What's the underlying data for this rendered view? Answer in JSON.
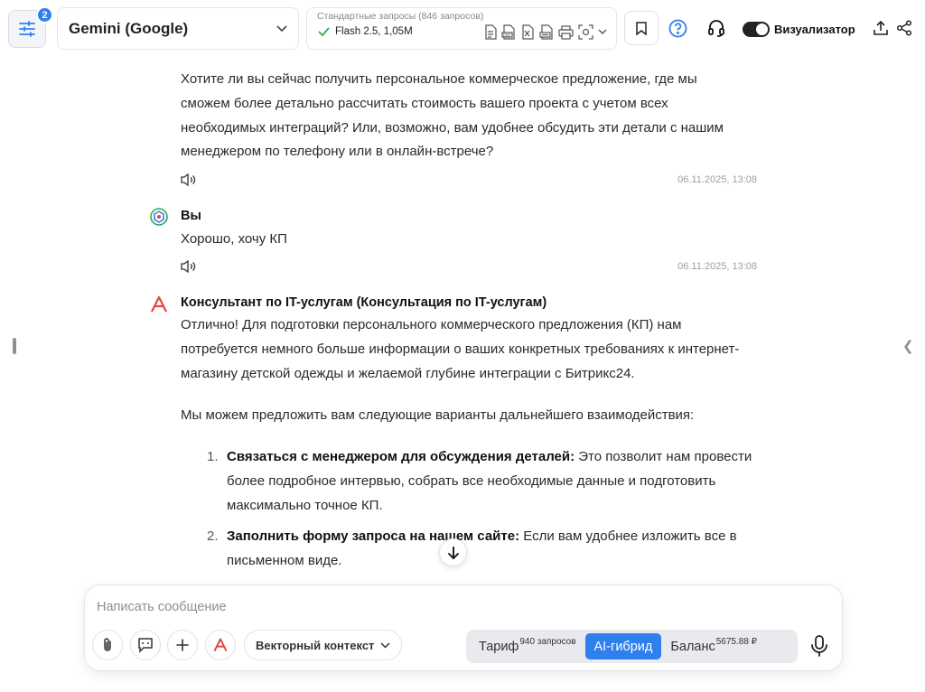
{
  "header": {
    "settings_badge": "2",
    "model_name": "Gemini (Google)",
    "requests_title": "Стандартные запросы (846 запросов)",
    "requests_model": "Flash 2.5, 1,05M",
    "visualizer_label": "Визуализатор"
  },
  "messages": {
    "m1": {
      "lines": [
        "Хотите ли вы сейчас получить персональное коммерческое предложение, где мы",
        "сможем более детально рассчитать стоимость вашего проекта с учетом всех",
        "необходимых интеграций? Или, возможно, вам удобнее обсудить эти детали с нашим",
        "менеджером по телефону или в онлайн-встрече?"
      ],
      "timestamp": "06.11.2025, 13:08"
    },
    "m2": {
      "author": "Вы",
      "text": "Хорошо, хочу КП",
      "timestamp": "06.11.2025, 13:08"
    },
    "m3": {
      "author": "Консультант по IT-услугам (Консультация по IT-услугам)",
      "intro_lines": [
        "Отлично! Для подготовки персонального коммерческого предложения (КП) нам",
        "потребуется немного больше информации о ваших конкретных требованиях к интернет-",
        "магазину детской одежды и желаемой глубине интеграции с Битрикс24."
      ],
      "options_intro": "Мы можем предложить вам следующие варианты дальнейшего взаимодействия:",
      "items": [
        {
          "num": "1.",
          "bold": "Связаться с менеджером для обсуждения деталей:",
          "lines": [
            "Это позволит нам провести",
            "более подробное интервью, собрать все необходимые данные и подготовить",
            "максимально точное КП."
          ]
        },
        {
          "num": "2.",
          "bold": "Заполнить форму запроса на нашем сайте:",
          "lines": [
            "Если вам удобнее изложить все в",
            "письменном виде."
          ]
        }
      ]
    }
  },
  "composer": {
    "placeholder": "Написать сообщение",
    "vector_context_label": "Векторный контекст",
    "modes": {
      "tariff": {
        "label": "Тариф",
        "sup": "940 запросов"
      },
      "hybrid": {
        "label": "AI-гибрид"
      },
      "balance": {
        "label": "Баланс",
        "sup": "5675.88 ₽"
      }
    }
  },
  "colors": {
    "accent": "#2f80ed",
    "check": "#34a853",
    "consultant_logo": "#e2463c"
  }
}
